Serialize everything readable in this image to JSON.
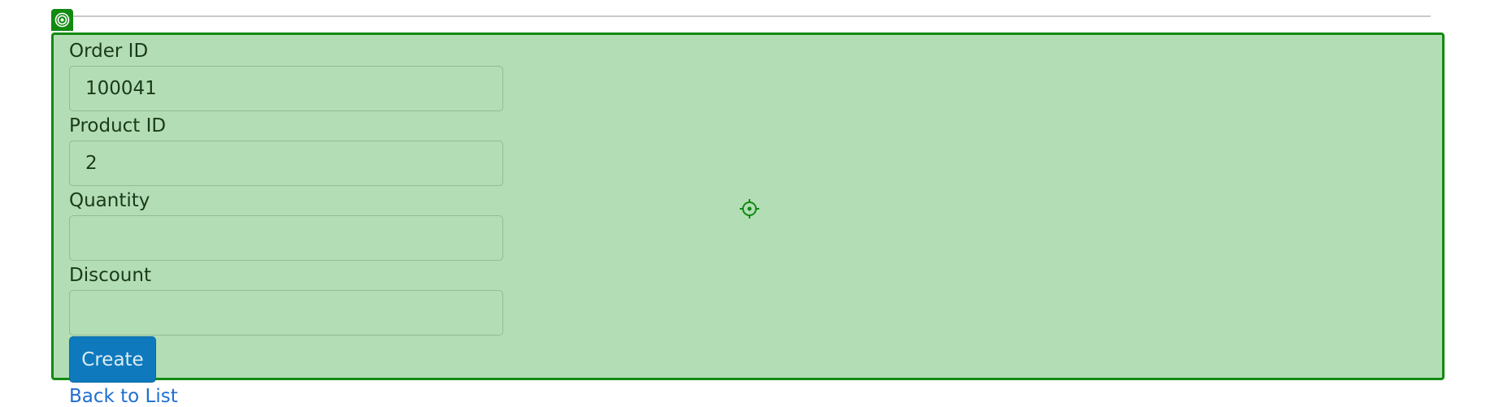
{
  "form": {
    "fields": [
      {
        "label": "Order ID",
        "value": "100041",
        "placeholder": ""
      },
      {
        "label": "Product ID",
        "value": "2",
        "placeholder": ""
      },
      {
        "label": "Quantity",
        "value": "",
        "placeholder": ""
      },
      {
        "label": "Discount",
        "value": "",
        "placeholder": ""
      }
    ],
    "submit_label": "Create"
  },
  "back_link_label": "Back to List",
  "colors": {
    "highlight_fill": "#b3ddb5",
    "highlight_border": "#128a12",
    "button": "#0e7abd",
    "link": "#1f6fd1"
  },
  "icons": [
    "target-icon",
    "crosshair-icon"
  ]
}
